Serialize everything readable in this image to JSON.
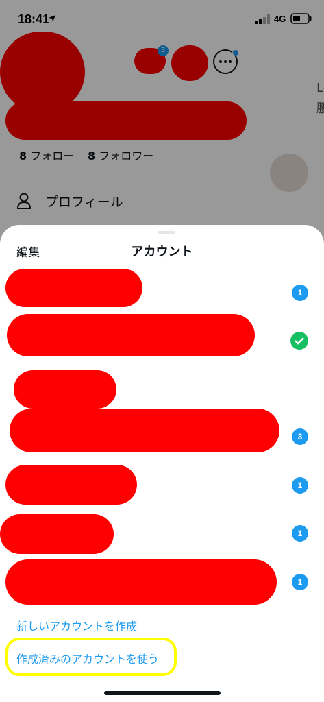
{
  "status_bar": {
    "time": "18:41",
    "network": "4G",
    "location_icon": "location-arrow-icon",
    "signal_icon": "signal-bars-icon",
    "battery_icon": "battery-icon"
  },
  "drawer": {
    "avatar_badge": "3",
    "following_count": "8",
    "following_label": "フォロー",
    "followers_count": "8",
    "followers_label": "フォロワー",
    "menu_items": [
      {
        "icon": "person-icon",
        "label": "プロフィール"
      }
    ],
    "more_icon": "ellipsis-icon"
  },
  "timeline_peek": {
    "text_line_1": "Le",
    "text_line_2": "腰"
  },
  "account_sheet": {
    "title": "アカウント",
    "edit_label": "編集",
    "accounts": [
      {
        "badge": "1"
      },
      {
        "selected": true,
        "icon": "check-icon"
      },
      {
        "badge": ""
      },
      {
        "badge": "3"
      },
      {
        "badge": "1"
      },
      {
        "badge": "1"
      },
      {
        "badge": "1"
      }
    ],
    "create_new_label": "新しいアカウントを作成",
    "use_existing_label": "作成済みのアカウントを使う"
  },
  "colors": {
    "accent": "#1d9bf0",
    "check_green": "#17bf63",
    "redaction": "#ff0000",
    "highlight": "#ffff00"
  }
}
